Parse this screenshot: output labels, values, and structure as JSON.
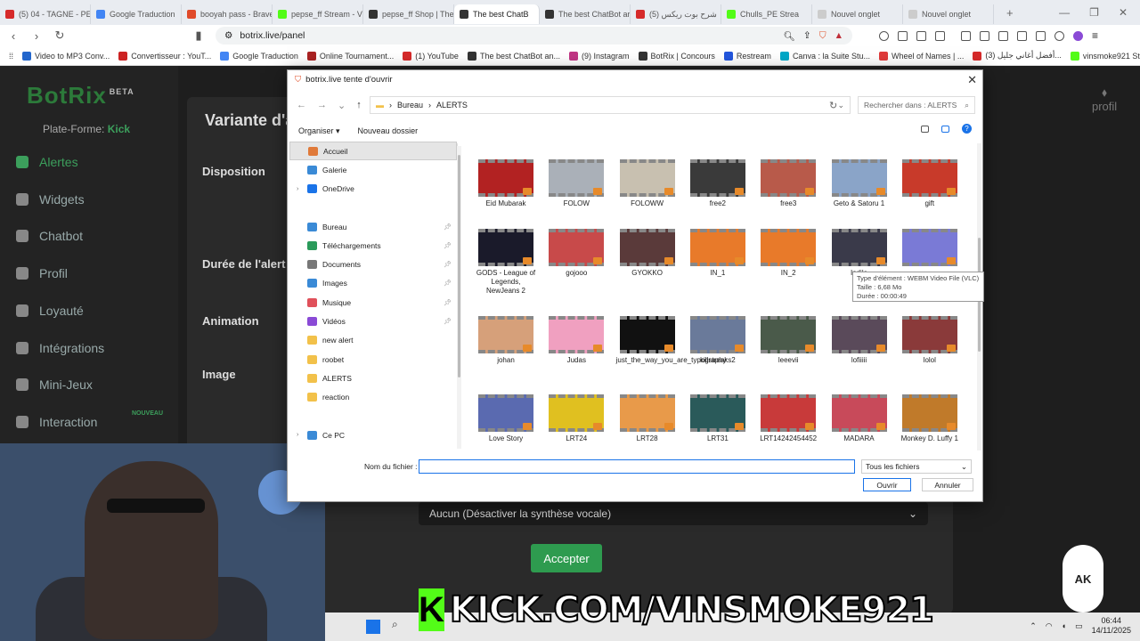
{
  "browser": {
    "tabs": [
      {
        "label": "(5) 04 - TAGNE - PE",
        "color": "#d62a2a"
      },
      {
        "label": "Google Traduction",
        "color": "#4285f4"
      },
      {
        "label": "booyah pass - Brave",
        "color": "#e04a2a"
      },
      {
        "label": "pepse_ff Stream - V",
        "color": "#53fc18"
      },
      {
        "label": "pepse_ff Shop | The",
        "color": "#333333"
      },
      {
        "label": "The best ChatB",
        "color": "#333333",
        "active": true
      },
      {
        "label": "The best ChatBot ar",
        "color": "#333333"
      },
      {
        "label": "(5) شرح بوت ريكس",
        "color": "#d62a2a"
      },
      {
        "label": "Chulls_PE Strea",
        "color": "#53fc18"
      },
      {
        "label": "Nouvel onglet",
        "color": "#cccccc"
      },
      {
        "label": "Nouvel onglet",
        "color": "#cccccc"
      }
    ],
    "url": "botrix.live/panel",
    "bookmarks": [
      {
        "label": "Video to MP3 Conv...",
        "color": "#2266cc"
      },
      {
        "label": "Convertisseur : YouT...",
        "color": "#cc2222"
      },
      {
        "label": "Google Traduction",
        "color": "#4285f4"
      },
      {
        "label": "Online Tournament...",
        "color": "#aa2222"
      },
      {
        "label": "(1) YouTube",
        "color": "#d62a2a"
      },
      {
        "label": "The best ChatBot an...",
        "color": "#333333"
      },
      {
        "label": "(9) Instagram",
        "color": "#c13584"
      },
      {
        "label": "BotRix | Concours",
        "color": "#333333"
      },
      {
        "label": "Restream",
        "color": "#2255dd"
      },
      {
        "label": "Canva : la Suite Stu...",
        "color": "#00a8c8"
      },
      {
        "label": "Wheel of Names | ...",
        "color": "#e03a3a"
      },
      {
        "label": "(3) أفضل أغاني جليل...",
        "color": "#d62a2a"
      },
      {
        "label": "vinsmoke921 Strea...",
        "color": "#53fc18"
      }
    ]
  },
  "botrix": {
    "logo": "BotRix",
    "beta": "BETA",
    "platform_label": "Plate-Forme:",
    "platform_value": "Kick",
    "profil": "profil",
    "nav": [
      {
        "label": "Alertes",
        "active": true
      },
      {
        "label": "Widgets"
      },
      {
        "label": "Chatbot"
      },
      {
        "label": "Profil"
      },
      {
        "label": "Loyauté"
      },
      {
        "label": "Intégrations"
      },
      {
        "label": "Mini-Jeux"
      },
      {
        "label": "Interaction"
      }
    ],
    "nouveau_badge": "NOUVEAU",
    "modal_title": "Variante d'a",
    "sections": [
      "Disposition",
      "Durée de l'alert",
      "Animation",
      "Image"
    ],
    "tts_value": "Aucun (Désactiver la synthèse vocale)",
    "accept_label": "Accepter"
  },
  "overlay": {
    "kick_text": "KICK.COM/VINSMOKE921",
    "kick_k": "K",
    "ak_logo": "AK"
  },
  "dialog": {
    "title": "botrix.live tente d'ouvrir",
    "path": [
      "Bureau",
      "ALERTS"
    ],
    "search_placeholder": "Rechercher dans : ALERTS",
    "organise": "Organiser",
    "new_folder": "Nouveau dossier",
    "nav_items": [
      {
        "label": "Accueil",
        "color": "#e07a3a",
        "sel": true
      },
      {
        "label": "Galerie",
        "color": "#3a8ad6"
      },
      {
        "label": "OneDrive",
        "color": "#1a73e8",
        "expander": true
      },
      {
        "gap": true
      },
      {
        "label": "Bureau",
        "color": "#3a8ad6",
        "pin": true
      },
      {
        "label": "Téléchargements",
        "color": "#2a9a5a",
        "pin": true
      },
      {
        "label": "Documents",
        "color": "#777777",
        "pin": true
      },
      {
        "label": "Images",
        "color": "#3a8ad6",
        "pin": true
      },
      {
        "label": "Musique",
        "color": "#e0505a",
        "pin": true
      },
      {
        "label": "Vidéos",
        "color": "#8a4ad6",
        "pin": true
      },
      {
        "label": "new alert",
        "color": "#f2c14a"
      },
      {
        "label": "roobet",
        "color": "#f2c14a"
      },
      {
        "label": "ALERTS",
        "color": "#f2c14a"
      },
      {
        "label": "reaction",
        "color": "#f2c14a"
      },
      {
        "gap": true
      },
      {
        "label": "Ce PC",
        "color": "#3a8ad6",
        "expander": true
      }
    ],
    "files": [
      {
        "label": "Eid Mubarak",
        "color": "#b22222"
      },
      {
        "label": "FOLOW",
        "color": "#aab0b8"
      },
      {
        "label": "FOLOWW",
        "color": "#c8c0b0"
      },
      {
        "label": "free2",
        "color": "#3a3a3a"
      },
      {
        "label": "free3",
        "color": "#b85a4a"
      },
      {
        "label": "Geto & Satoru 1",
        "color": "#8aa4c8"
      },
      {
        "label": "gift",
        "color": "#c83a2a"
      },
      {
        "label": "GODS - League of Legends, NewJeans 2",
        "color": "#1a1a2a"
      },
      {
        "label": "gojooo",
        "color": "#c84a4a"
      },
      {
        "label": "GYOKKO",
        "color": "#5a3a3a"
      },
      {
        "label": "IN_1",
        "color": "#e87a2a"
      },
      {
        "label": "IN_2",
        "color": "#e87a2a"
      },
      {
        "label": "Indila",
        "color": "#3a3a4a"
      },
      {
        "label": "",
        "color": "#7a7ad6"
      },
      {
        "label": "johan",
        "color": "#d6a07a"
      },
      {
        "label": "Judas",
        "color": "#f0a0c0"
      },
      {
        "label": "just_the_way_you_are_typography",
        "color": "#111111"
      },
      {
        "label": "killstreaks2",
        "color": "#6a7a9a"
      },
      {
        "label": "leeevii",
        "color": "#4a5a4a"
      },
      {
        "label": "lofiiiii",
        "color": "#5a4a5a"
      },
      {
        "label": "lolol",
        "color": "#8a3a3a"
      },
      {
        "label": "Love Story",
        "color": "#5a6ab0"
      },
      {
        "label": "LRT24",
        "color": "#e0c020"
      },
      {
        "label": "LRT28",
        "color": "#e89a4a"
      },
      {
        "label": "LRT31",
        "color": "#2a5a5a"
      },
      {
        "label": "LRT14242454452",
        "color": "#c83a3a"
      },
      {
        "label": "MADARA",
        "color": "#c84a5a"
      },
      {
        "label": "Monkey D. Luffy 1",
        "color": "#c07a2a"
      }
    ],
    "tooltip": [
      "Type d'élément : WEBM Video File (VLC)",
      "Taille : 6,68 Mo",
      "Durée : 00:00:49"
    ],
    "filename_label": "Nom du fichier :",
    "filename_value": "",
    "filetype_label": "Tous les fichiers",
    "open_label": "Ouvrir",
    "cancel_label": "Annuler"
  },
  "taskbar": {
    "time": "06:44",
    "date": "14/11/2025"
  }
}
